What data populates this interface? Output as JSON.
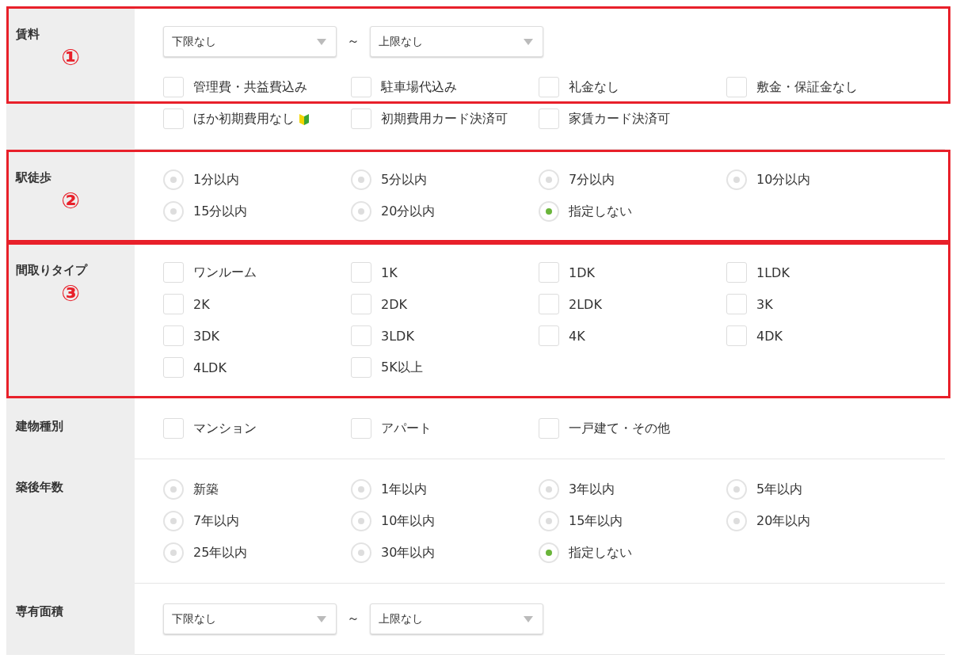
{
  "sections": [
    {
      "label": "賃料",
      "annotation": {
        "number": "①",
        "covers_whole_row": false
      },
      "parts": [
        {
          "kind": "range",
          "min": {
            "value": "下限なし"
          },
          "separator": "～",
          "max": {
            "value": "上限なし"
          }
        },
        {
          "kind": "checkboxes",
          "options": [
            {
              "label": "管理費・共益費込み",
              "checked": false,
              "beginner_mark": false
            },
            {
              "label": "駐車場代込み",
              "checked": false,
              "beginner_mark": false
            },
            {
              "label": "礼金なし",
              "checked": false,
              "beginner_mark": false
            },
            {
              "label": "敷金・保証金なし",
              "checked": false,
              "beginner_mark": false
            },
            {
              "label": "ほか初期費用なし",
              "checked": false,
              "beginner_mark": true
            },
            {
              "label": "初期費用カード決済可",
              "checked": false,
              "beginner_mark": false
            },
            {
              "label": "家賃カード決済可",
              "checked": false,
              "beginner_mark": false
            }
          ]
        }
      ]
    },
    {
      "label": "駅徒歩",
      "annotation": {
        "number": "②",
        "covers_whole_row": true
      },
      "parts": [
        {
          "kind": "radios",
          "options": [
            {
              "label": "1分以内",
              "selected": false
            },
            {
              "label": "5分以内",
              "selected": false
            },
            {
              "label": "7分以内",
              "selected": false
            },
            {
              "label": "10分以内",
              "selected": false
            },
            {
              "label": "15分以内",
              "selected": false
            },
            {
              "label": "20分以内",
              "selected": false
            },
            {
              "label": "指定しない",
              "selected": true
            }
          ]
        }
      ]
    },
    {
      "label": "間取りタイプ",
      "annotation": {
        "number": "③",
        "covers_whole_row": true
      },
      "parts": [
        {
          "kind": "checkboxes",
          "options": [
            {
              "label": "ワンルーム",
              "checked": false
            },
            {
              "label": "1K",
              "checked": false
            },
            {
              "label": "1DK",
              "checked": false
            },
            {
              "label": "1LDK",
              "checked": false
            },
            {
              "label": "2K",
              "checked": false
            },
            {
              "label": "2DK",
              "checked": false
            },
            {
              "label": "2LDK",
              "checked": false
            },
            {
              "label": "3K",
              "checked": false
            },
            {
              "label": "3DK",
              "checked": false
            },
            {
              "label": "3LDK",
              "checked": false
            },
            {
              "label": "4K",
              "checked": false
            },
            {
              "label": "4DK",
              "checked": false
            },
            {
              "label": "4LDK",
              "checked": false
            },
            {
              "label": "5K以上",
              "checked": false
            }
          ]
        }
      ]
    },
    {
      "label": "建物種別",
      "parts": [
        {
          "kind": "checkboxes",
          "options": [
            {
              "label": "マンション",
              "checked": false
            },
            {
              "label": "アパート",
              "checked": false
            },
            {
              "label": "一戸建て・その他",
              "checked": false
            }
          ]
        }
      ]
    },
    {
      "label": "築後年数",
      "parts": [
        {
          "kind": "radios",
          "options": [
            {
              "label": "新築",
              "selected": false
            },
            {
              "label": "1年以内",
              "selected": false
            },
            {
              "label": "3年以内",
              "selected": false
            },
            {
              "label": "5年以内",
              "selected": false
            },
            {
              "label": "7年以内",
              "selected": false
            },
            {
              "label": "10年以内",
              "selected": false
            },
            {
              "label": "15年以内",
              "selected": false
            },
            {
              "label": "20年以内",
              "selected": false
            },
            {
              "label": "25年以内",
              "selected": false
            },
            {
              "label": "30年以内",
              "selected": false
            },
            {
              "label": "指定しない",
              "selected": true
            }
          ]
        }
      ]
    },
    {
      "label": "専有面積",
      "parts": [
        {
          "kind": "range",
          "min": {
            "value": "下限なし"
          },
          "separator": "～",
          "max": {
            "value": "上限なし"
          }
        }
      ]
    }
  ]
}
